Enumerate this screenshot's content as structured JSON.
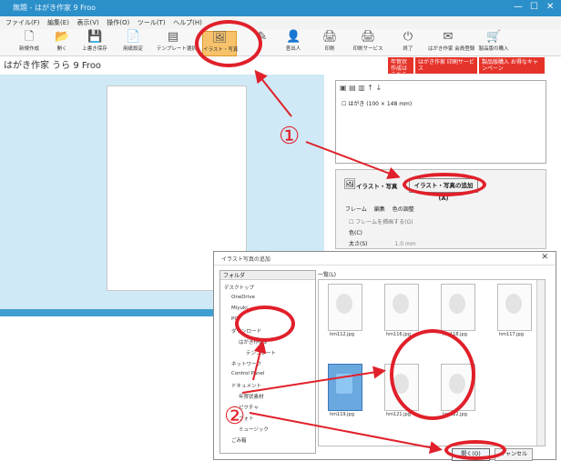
{
  "window": {
    "title": "無題 - はがき作家 9 Froo",
    "app_name": "はがき作家 うら 9 Froo",
    "controls": [
      "—",
      "☐",
      "✕"
    ]
  },
  "menu": [
    "ファイル(F)",
    "編集(E)",
    "表示(V)",
    "操作(O)",
    "ツール(T)",
    "ヘルプ(H)"
  ],
  "toolbar": [
    {
      "label": "新規作成",
      "icon": "new-doc-icon",
      "glyph": "🗋"
    },
    {
      "label": "開く",
      "icon": "folder-icon",
      "glyph": "📂"
    },
    {
      "label": "上書き保存",
      "icon": "save-icon",
      "glyph": "💾"
    },
    {
      "label": "用紙設定",
      "icon": "paper-icon",
      "glyph": "📄"
    },
    {
      "label": "テンプレート選択",
      "icon": "template-icon",
      "glyph": "▤"
    },
    {
      "label": "イラスト・写真",
      "icon": "illustration-icon",
      "glyph": "🖼"
    },
    {
      "label": "",
      "icon": "pen-icon",
      "glyph": "✎"
    },
    {
      "label": "差出人",
      "icon": "sender-icon",
      "glyph": "👤"
    },
    {
      "label": "印刷",
      "icon": "print-icon",
      "glyph": "🖨"
    },
    {
      "label": "印刷サービス",
      "icon": "print-service-icon",
      "glyph": "🖨"
    },
    {
      "label": "終了",
      "icon": "exit-icon",
      "glyph": "⏻"
    },
    {
      "label": "はがき作家 会員登録",
      "icon": "register-icon",
      "glyph": "✉"
    },
    {
      "label": "製品版の購入",
      "icon": "buy-icon",
      "glyph": "🛒"
    }
  ],
  "banners": [
    {
      "text": "年賀状 作成はこちら",
      "color": "#e6332a"
    },
    {
      "text": "はがき作家 印刷サービス",
      "color": "#e6332a"
    },
    {
      "text": "製品版購入 お得なキャンペーン",
      "color": "#e6332a"
    }
  ],
  "layer_panel": {
    "item": "はがき (100 × 148 mm)"
  },
  "illustration_panel": {
    "title": "イラスト・写真",
    "add_button": "イラスト・写真の追加(A)",
    "tabs": [
      "フレーム",
      "編集",
      "色の調整"
    ],
    "frame_checkbox": "フレームを挿画する(G)",
    "color_label": "色(C)",
    "size_label": "太さ(S)",
    "size_value": "1.0 mm"
  },
  "dialog": {
    "title": "イラスト写真の追加",
    "folder_header": "フォルダ",
    "list_header": "一覧(L)",
    "tree": [
      {
        "label": "デスクトップ",
        "indent": 0
      },
      {
        "label": "OneDrive",
        "indent": 1
      },
      {
        "label": "Miyuki",
        "indent": 1
      },
      {
        "label": "PC",
        "indent": 1
      },
      {
        "label": "ダウンロード",
        "indent": 1
      },
      {
        "label": "はがき作家9",
        "indent": 2
      },
      {
        "label": "テンプレート",
        "indent": 3
      },
      {
        "label": "ネットワーク",
        "indent": 1
      },
      {
        "label": "Control Panel",
        "indent": 1
      },
      {
        "label": "ドキュメント",
        "indent": 1
      },
      {
        "label": "年賀状素材",
        "indent": 2
      },
      {
        "label": "ピクチャ",
        "indent": 2
      },
      {
        "label": "フォト",
        "indent": 2
      },
      {
        "label": "ミュージック",
        "indent": 2
      },
      {
        "label": "ごみ箱",
        "indent": 1
      }
    ],
    "files": [
      "hm112.jpg",
      "hm116.jpg",
      "hm118.jpg",
      "hm117.jpg",
      "hm119.jpg",
      "hm121.jpg",
      "hm122.jpg"
    ],
    "selected_index": 4,
    "ok_button": "開く(O)",
    "cancel_button": "キャンセル"
  },
  "annotations": {
    "step1": "①",
    "step2": "②",
    "color": "#e0202a"
  }
}
